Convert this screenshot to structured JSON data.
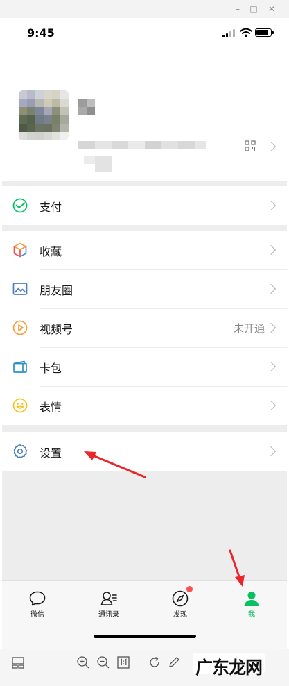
{
  "status_bar": {
    "time": "9:45"
  },
  "pay": {
    "label": "支付"
  },
  "services": [
    {
      "id": "favorites",
      "label": "收藏",
      "value": ""
    },
    {
      "id": "moments",
      "label": "朋友圈",
      "value": ""
    },
    {
      "id": "channels",
      "label": "视频号",
      "value": "未开通"
    },
    {
      "id": "cards",
      "label": "卡包",
      "value": ""
    },
    {
      "id": "stickers",
      "label": "表情",
      "value": ""
    }
  ],
  "settings": {
    "label": "设置"
  },
  "tabbar": {
    "items": [
      {
        "label": "微信",
        "icon": "chat-bubble-icon"
      },
      {
        "label": "通讯录",
        "icon": "contacts-icon"
      },
      {
        "label": "发现",
        "icon": "compass-icon"
      },
      {
        "label": "我",
        "icon": "person-icon"
      }
    ],
    "active": "我"
  },
  "toolbar": {
    "watermark": "广东龙网"
  },
  "colors": {
    "accent": "#07c160",
    "badge": "#fa5151",
    "arrow": "#e8262b"
  }
}
